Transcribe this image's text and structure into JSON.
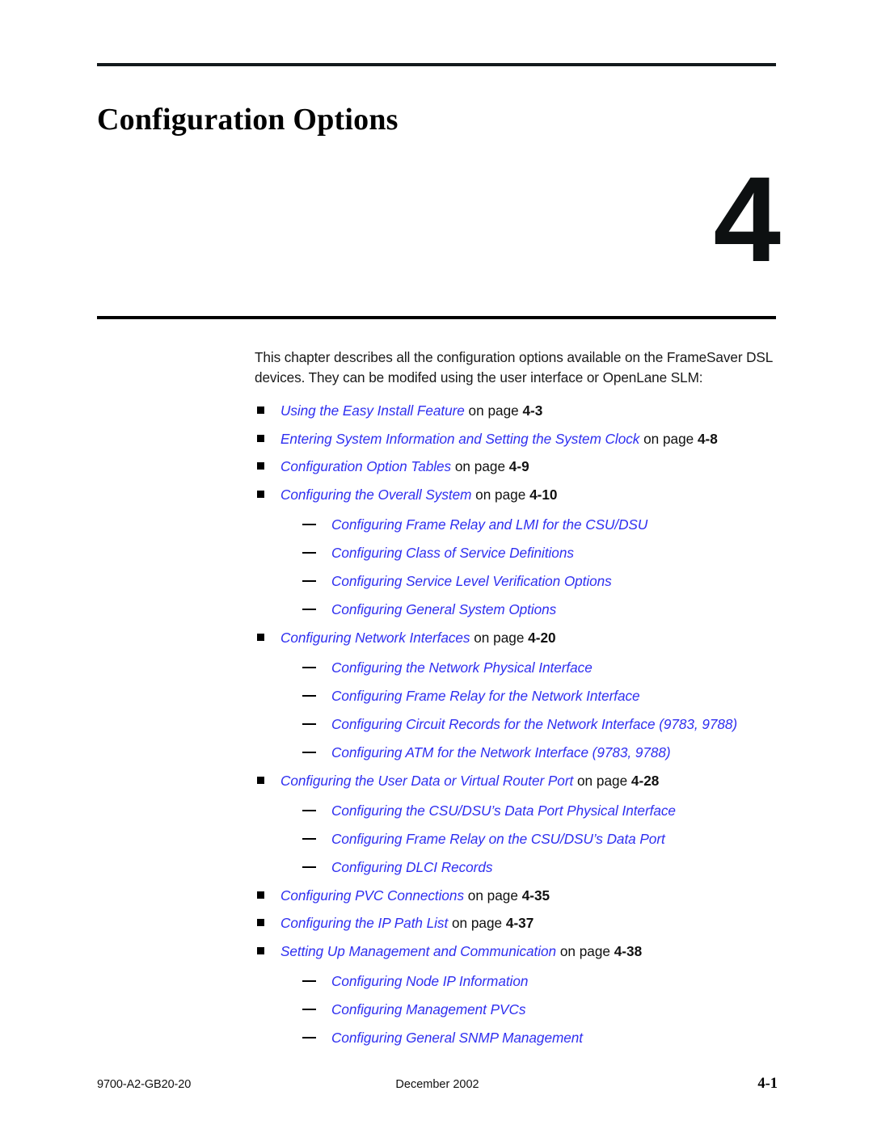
{
  "page": {
    "chapter_title": "Configuration Options",
    "chapter_number": "4",
    "intro": "This chapter describes all the configuration options available on the FrameSaver DSL devices. They can be modifed using the user interface or OpenLane SLM:"
  },
  "toc": [
    {
      "link": "Using the Easy Install Feature",
      "tail": " on page ",
      "page": "4-3",
      "children": []
    },
    {
      "link": "Entering System Information and Setting the System Clock",
      "tail": " on page ",
      "page": "4-8",
      "children": []
    },
    {
      "link": "Configuration Option Tables",
      "tail": " on page ",
      "page": "4-9",
      "children": []
    },
    {
      "link": "Configuring the Overall System",
      "tail": " on page ",
      "page": "4-10",
      "children": [
        "Configuring Frame Relay and LMI for the CSU/DSU",
        "Configuring Class of Service Definitions",
        "Configuring Service Level Verification Options",
        "Configuring General System Options"
      ]
    },
    {
      "link": "Configuring Network Interfaces",
      "tail": " on page ",
      "page": "4-20",
      "children": [
        "Configuring the Network Physical Interface",
        "Configuring Frame Relay for the Network Interface",
        "Configuring Circuit Records for the Network Interface (9783, 9788)",
        "Configuring ATM for the Network Interface (9783, 9788)"
      ]
    },
    {
      "link": "Configuring the User Data or Virtual Router Port",
      "tail": " on page ",
      "page": "4-28",
      "children": [
        "Configuring the CSU/DSU’s Data Port Physical Interface",
        "Configuring Frame Relay on the CSU/DSU’s Data Port",
        "Configuring DLCI Records"
      ]
    },
    {
      "link": "Configuring PVC Connections",
      "tail": " on page ",
      "page": "4-35",
      "children": []
    },
    {
      "link": "Configuring the IP Path List",
      "tail": " on page ",
      "page": "4-37",
      "children": []
    },
    {
      "link": "Setting Up Management and Communication",
      "tail": " on page ",
      "page": "4-38",
      "children": [
        "Configuring Node IP Information",
        "Configuring Management PVCs",
        "Configuring General SNMP Management"
      ]
    }
  ],
  "footer": {
    "document_number": "9700-A2-GB20-20",
    "date": "December 2002",
    "page_number": "4-1"
  },
  "colors": {
    "link": "#2f2ff0",
    "text": "#111111",
    "rule": "#13191c"
  }
}
